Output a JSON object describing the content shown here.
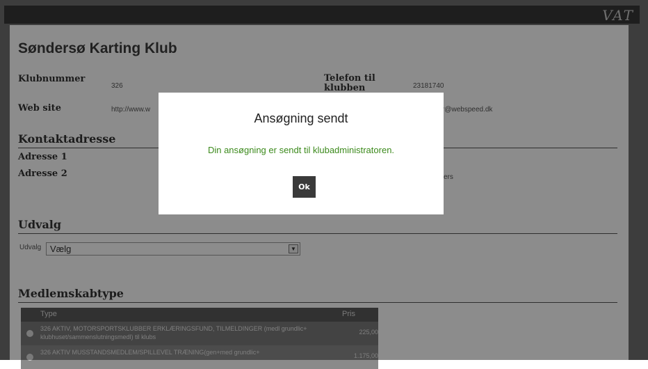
{
  "header": {
    "logo": "VAT"
  },
  "club": {
    "name": "Søndersø Karting Klub",
    "fields": {
      "klubnummer_label": "Klubnummer",
      "klubnummer_value": "326",
      "telefon_label": "Telefon til klubben",
      "telefon_value": "23181740",
      "website_label": "Web site",
      "website_value": "http://www.w",
      "email_value": "r@webspeed.dk"
    }
  },
  "contact": {
    "heading": "Kontaktadresse",
    "adresse1_label": "Adresse 1",
    "adresse2_label": "Adresse 2",
    "right_value": "ers"
  },
  "udvalg": {
    "heading": "Udvalg",
    "select_label": "Udvalg",
    "select_value": "Vælg"
  },
  "membership": {
    "heading": "Medlemskabtype",
    "columns": [
      "Type",
      "Pris"
    ],
    "rows": [
      {
        "name": "326 AKTIV, MOTORSPORTSKLUBBER ERKLÆRINGSFUND, TILMELDINGER (medl grundlic+ klubhuset/sammenslutningsmedl) til klubs",
        "price": "225,00"
      },
      {
        "name": "326 AKTIV MUSSTANDSMEDLEM/SPILLEVEL TRÆNING(gen+med grundlic+",
        "price": "1.175,00"
      }
    ]
  },
  "modal": {
    "title": "Ansøgning sendt",
    "message": "Din ansøgning er sendt til klubadministratoren.",
    "ok_label": "Ok"
  },
  "colors": {
    "success_text": "#3c8a1c",
    "overlay": "rgba(0,0,0,0.45)",
    "button_bg": "#3a3a3a"
  }
}
